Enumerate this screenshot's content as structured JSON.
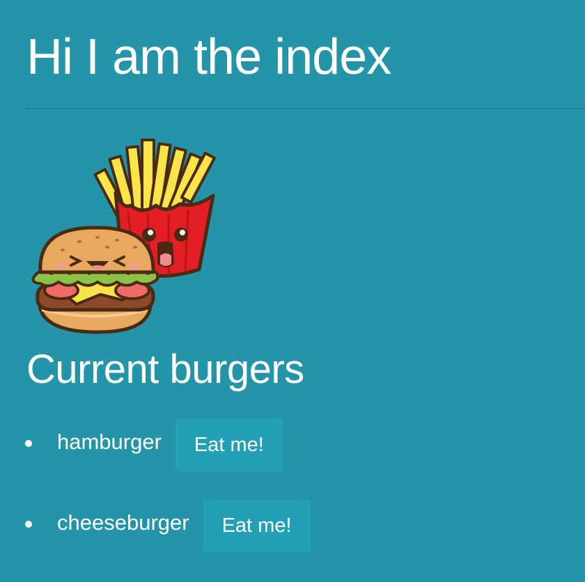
{
  "header": {
    "title": "Hi I am the index"
  },
  "hero": {
    "image": "burger-and-fries-cartoon",
    "colors": {
      "background": "#2494a9",
      "bun": "#e8a860",
      "lettuce": "#8cc24a",
      "cheese": "#f7e24a",
      "fries_box": "#e31e24",
      "fries": "#fbe34a"
    }
  },
  "burgers": {
    "section_title": "Current burgers",
    "items": [
      {
        "name": "hamburger",
        "button_label": "Eat me!"
      },
      {
        "name": "cheeseburger",
        "button_label": "Eat me!"
      }
    ]
  },
  "theme": {
    "background": "#2494a9",
    "button": "#23a0b6",
    "text": "#ffffff"
  }
}
